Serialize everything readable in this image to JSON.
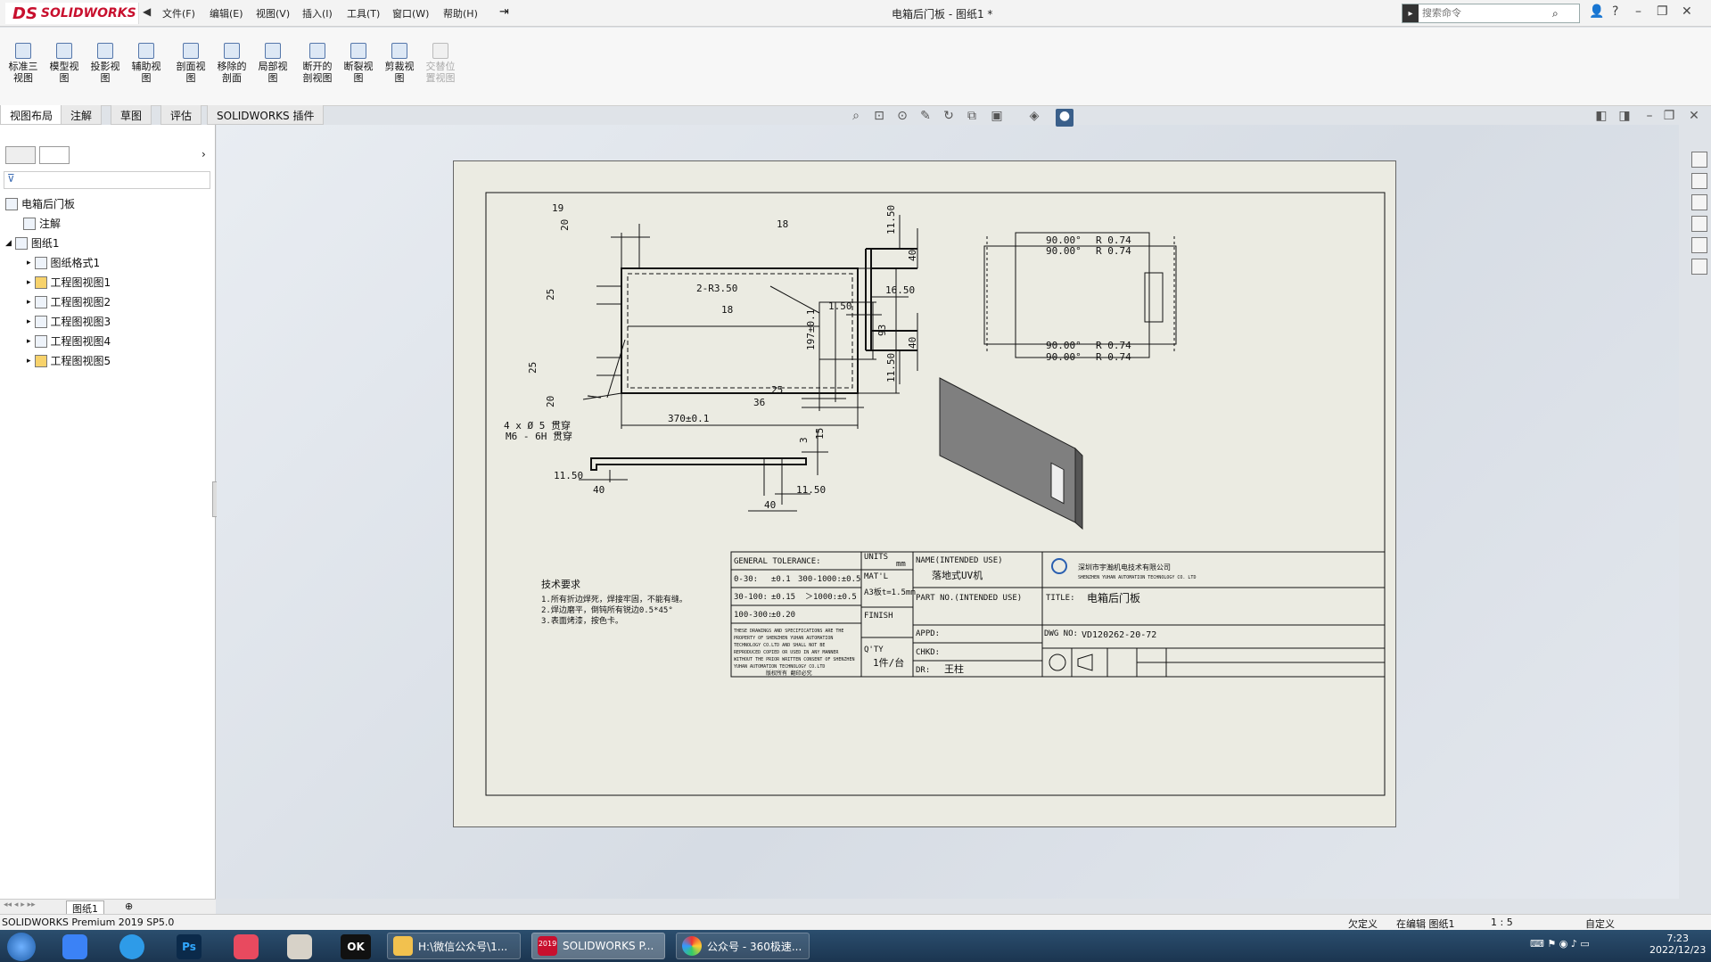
{
  "app": {
    "logo_text": "SOLIDWORKS",
    "logo_mark": "DS",
    "doc_title": "电箱后门板 - 图纸1 *",
    "search_placeholder": "搜索命令"
  },
  "menu": [
    "文件(F)",
    "编辑(E)",
    "视图(V)",
    "插入(I)",
    "工具(T)",
    "窗口(W)",
    "帮助(H)"
  ],
  "ribbon": {
    "buttons": [
      {
        "label": "标准三\n视图",
        "enabled": true
      },
      {
        "label": "模型视\n图",
        "enabled": true
      },
      {
        "label": "投影视\n图",
        "enabled": true
      },
      {
        "label": "辅助视\n图",
        "enabled": true
      },
      {
        "label": "剖面视\n图",
        "enabled": true
      },
      {
        "label": "移除的\n剖面",
        "enabled": true
      },
      {
        "label": "局部视\n图",
        "enabled": true
      },
      {
        "label": "断开的\n剖视图",
        "enabled": true
      },
      {
        "label": "断裂视\n图",
        "enabled": true
      },
      {
        "label": "剪裁视\n图",
        "enabled": true
      },
      {
        "label": "交替位\n置视图",
        "enabled": false
      }
    ]
  },
  "tabs": [
    {
      "label": "视图布局",
      "active": true
    },
    {
      "label": "注解",
      "active": false
    },
    {
      "label": "草图",
      "active": false
    },
    {
      "label": "评估",
      "active": false
    },
    {
      "label": "SOLIDWORKS 插件",
      "active": false
    }
  ],
  "tree": {
    "root": "电箱后门板",
    "annotations": "注解",
    "sheet": "图纸1",
    "items": [
      "图纸格式1",
      "工程图视图1",
      "工程图视图2",
      "工程图视图3",
      "工程图视图4",
      "工程图视图5"
    ]
  },
  "sheet_tabs": {
    "active": "图纸1"
  },
  "status": {
    "left": "SOLIDWORKS Premium 2019 SP5.0",
    "state": "欠定义",
    "editing": "在编辑 图纸1",
    "scale": "1 : 5",
    "custom": "自定义"
  },
  "taskbar": {
    "items": [
      "H:\\微信公众号\\1...",
      "SOLIDWORKS P...",
      "公众号 - 360极速..."
    ],
    "time": "7:23",
    "date": "2022/12/23",
    "sw_year": "2019"
  },
  "drawing": {
    "dims": {
      "d19": "19",
      "d20a": "20",
      "d25a": "25",
      "d18a": "18",
      "r350": "2-R3.50",
      "d18b": "18",
      "d93": "93",
      "d197": "197±0.1",
      "d25b": "25",
      "d20b": "20",
      "d25c": "25",
      "d36": "36",
      "d370": "370±0.1",
      "hole1": "4 x Ø 5 贯穿",
      "hole2": "M6 - 6H 贯穿",
      "s1150a": "11.50",
      "s40a": "40",
      "s1650": "16.50",
      "s150": "1.50",
      "s40b": "40",
      "s1150b": "11.50",
      "a1": "90.00°",
      "a2": "R 0.74",
      "a3": "90.00°",
      "a4": "R 0.74",
      "a5": "90.00°",
      "a6": "R 0.74",
      "a7": "90.00°",
      "a8": "R 0.74",
      "b1150a": "11.50",
      "b40a": "40",
      "b3": "3",
      "b15": "15",
      "b1150b": "11.50",
      "b40b": "40"
    },
    "tech_title": "技术要求",
    "tech": [
      "1.所有折边焊死，焊接牢固，不能有缝。",
      "2.焊边磨平，倒钝所有锐边0.5*45°",
      "3.表面烤漆，按色卡。"
    ],
    "tb": {
      "gt": "GENERAL TOLERANCE:",
      "r1a": "0-30:",
      "r1b": "±0.1",
      "r1c": "300-1000:±0.5",
      "r2a": "30-100:",
      "r2b": "±0.15",
      "r2c": "＞1000:±0.5",
      "r3a": "100-300:",
      "r3b": "±0.20",
      "units": "UNITS",
      "mm": "mm",
      "matl": "MAT'L",
      "matv": "A3板t=1.5mm",
      "finish": "FINISH",
      "qty": "Q'TY",
      "qtyv": "1件/台",
      "name": "NAME(INTENDED USE)",
      "namev": "落地式UV机",
      "partno": "PART NO.(INTENDED USE)",
      "appd": "APPD:",
      "chkd": "CHKD:",
      "dr": "DR:",
      "drv": "王柱",
      "company": "深圳市宇瀚机电技术有限公司",
      "company_en": "SHENZHEN YUHAN AUTOMATION TECHNOLOGY CO. LTD",
      "title": "TITLE:",
      "titlev": "电箱后门板",
      "dwgno": "DWG NO:",
      "dwgv": "VD120262-20-72",
      "prop": [
        "THESE DRAWINGS AND SPECIFICATIONS ARE THE",
        "PROPERTY OF SHENZHEN YUHAN AUTOMATION",
        "TECHNOLOGY CO.LTD AND SHALL NOT BE",
        "REPRODUCED COPIED OR USED IN ANY MANNER",
        "WITHOUT THE PRIOR WRITTEN CONSENT OF SHENZHEN",
        "YUHAN AUTOMATION TECHNOLOGY CO.LTD"
      ],
      "propcn": "版权所有 翻印必究"
    }
  }
}
